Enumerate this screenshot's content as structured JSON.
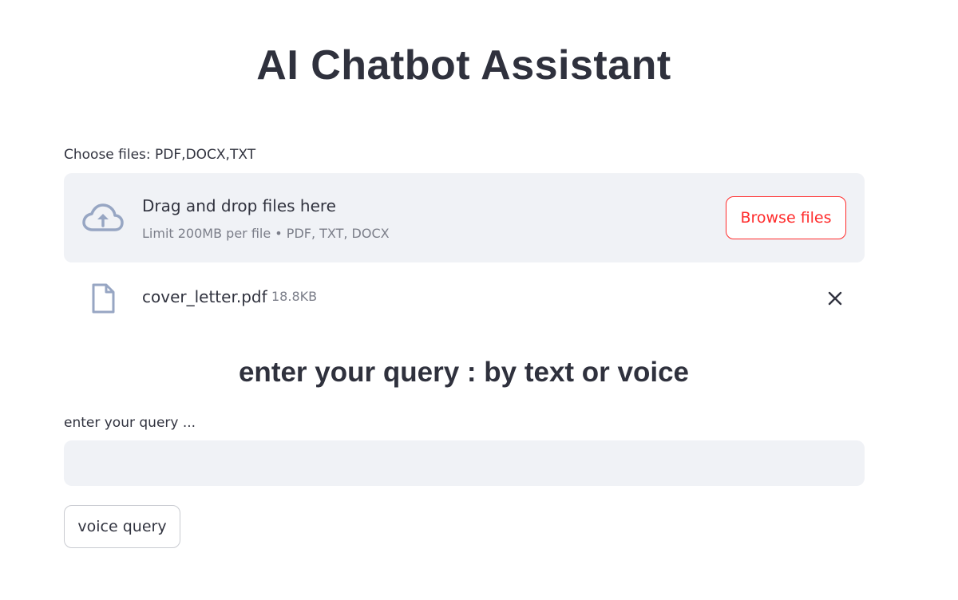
{
  "header": {
    "title": "AI Chatbot Assistant"
  },
  "uploader": {
    "label": "Choose files: PDF,DOCX,TXT",
    "dropzone_title": "Drag and drop files here",
    "dropzone_subtitle": "Limit 200MB per file • PDF, TXT, DOCX",
    "browse_label": "Browse files",
    "upload_icon": "cloud-upload-icon"
  },
  "uploaded_files": [
    {
      "name": "cover_letter.pdf",
      "size": "18.8KB",
      "icon": "file-icon"
    }
  ],
  "query": {
    "heading": "enter your query : by text or voice",
    "label": "enter your query ...",
    "value": "",
    "voice_button_label": "voice query"
  },
  "colors": {
    "accent": "#ff2b2b",
    "text": "#31333f",
    "muted_text": "#7b7e89",
    "input_bg": "#f0f2f6",
    "icon": "#97a6c3"
  }
}
